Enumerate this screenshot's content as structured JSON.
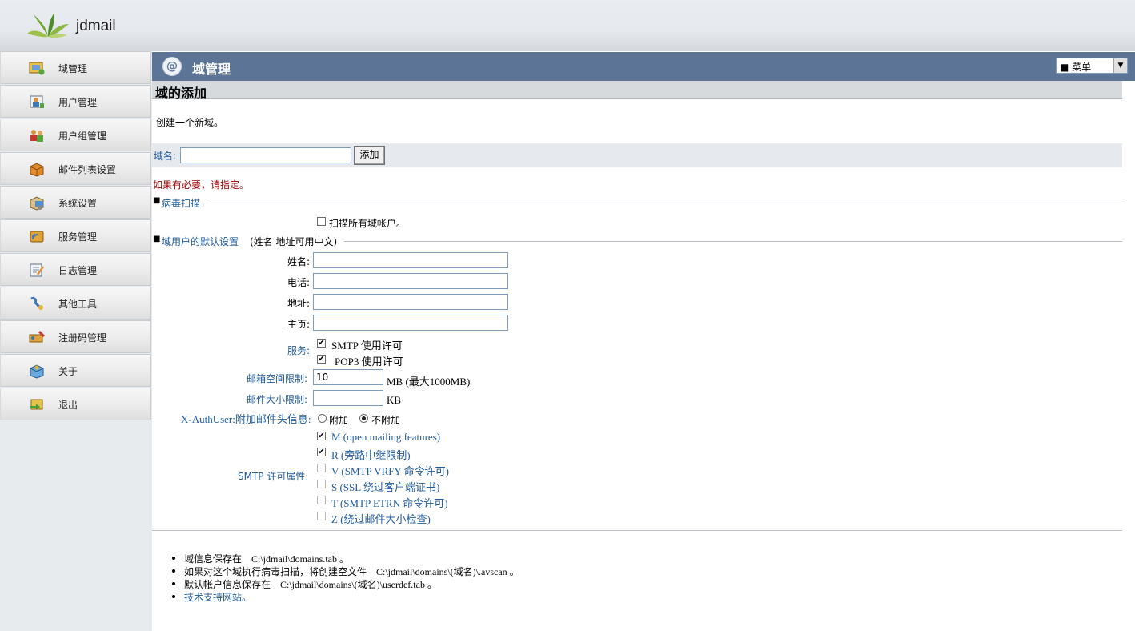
{
  "header": {
    "brand": "jdmail"
  },
  "sidebar": {
    "items": [
      {
        "label": "域管理",
        "icon": "domain-icon"
      },
      {
        "label": "用户管理",
        "icon": "user-icon"
      },
      {
        "label": "用户组管理",
        "icon": "user-group-icon"
      },
      {
        "label": "邮件列表设置",
        "icon": "mailing-list-icon"
      },
      {
        "label": "系统设置",
        "icon": "system-settings-icon"
      },
      {
        "label": "服务管理",
        "icon": "service-icon"
      },
      {
        "label": "日志管理",
        "icon": "log-icon"
      },
      {
        "label": "其他工具",
        "icon": "tools-icon"
      },
      {
        "label": "注册码管理",
        "icon": "license-icon"
      },
      {
        "label": "关于",
        "icon": "about-icon"
      },
      {
        "label": "退出",
        "icon": "logout-icon"
      }
    ]
  },
  "titlebar": {
    "title": "域管理",
    "menu_select": "■ 菜单"
  },
  "section": {
    "title": "域的添加",
    "description": "创建一个新域。"
  },
  "domain_form": {
    "label": "域名:",
    "value": "",
    "add_button": "添加"
  },
  "notice": "如果有必要，请指定。",
  "virus_scan": {
    "legend": "病毒扫描",
    "scan_all": {
      "label": "扫描所有域帐户。",
      "checked": false
    }
  },
  "defaults": {
    "legend": "域用户的默认设置",
    "legend_note": "(姓名 地址可用中文)",
    "name_label": "姓名:",
    "name_value": "",
    "phone_label": "电话:",
    "phone_value": "",
    "address_label": "地址:",
    "address_value": "",
    "homepage_label": "主页:",
    "homepage_value": "",
    "service_label": "服务:",
    "smtp_label": "SMTP 使用许可",
    "smtp_checked": true,
    "pop3_label": "POP3 使用许可",
    "pop3_checked": true,
    "mailbox_label": "邮箱空间限制:",
    "mailbox_value": "10",
    "mailbox_unit": "MB (最大1000MB)",
    "msgsize_label": "邮件大小限制:",
    "msgsize_value": "",
    "msgsize_unit": "KB",
    "xauth_label": "X-AuthUser:附加邮件头信息:",
    "xauth_attach": "附加",
    "xauth_noattach": "不附加",
    "xauth_selected": "不附加",
    "smtp_attr_label": "SMTP 许可属性:",
    "smtp_attrs": [
      {
        "label": "M (open mailing features)",
        "checked": true
      },
      {
        "label": "R (旁路中继限制)",
        "checked": true
      },
      {
        "label": "V (SMTP VRFY 命令许可)",
        "checked": false
      },
      {
        "label": "S (SSL 绕过客户端证书)",
        "checked": false
      },
      {
        "label": "T (SMTP ETRN 命令许可)",
        "checked": false
      },
      {
        "label": "Z (绕过邮件大小检查)",
        "checked": false
      }
    ]
  },
  "footer_notes": [
    "域信息保存在　C:\\jdmail\\domains.tab 。",
    "如果对这个域执行病毒扫描，将创建空文件　C:\\jdmail\\domains\\(域名)\\.avscan 。",
    "默认帐户信息保存在　C:\\jdmail\\domains\\(域名)\\userdef.tab 。"
  ],
  "support_link": "技术支持网站。"
}
